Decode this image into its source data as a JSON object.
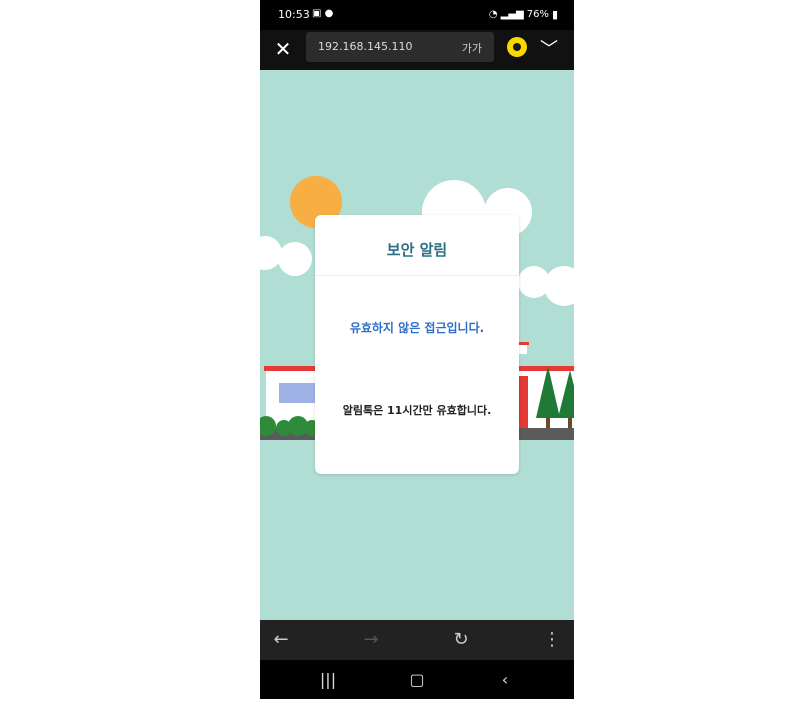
{
  "status_bar": {
    "time": "10:53",
    "battery": "76%"
  },
  "browser": {
    "url": "192.168.145.110",
    "text_size_label": "가가"
  },
  "modal": {
    "title": "보안 알림",
    "message_primary": "유효하지 않은 접근입니다.",
    "message_secondary": "알림톡은 11시간만 유효합니다."
  },
  "colors": {
    "background": "#b0ddd4",
    "title": "#2a6f86",
    "message_primary": "#2d6fc9",
    "sun": "#f7ae43",
    "kakao": "#f7d900"
  },
  "icons": {
    "close": "close-icon",
    "kakao": "kakao-icon",
    "chevron": "chevron-down-icon",
    "back": "arrow-left-icon",
    "forward": "arrow-right-icon",
    "refresh": "refresh-icon",
    "more": "more-vertical-icon"
  }
}
